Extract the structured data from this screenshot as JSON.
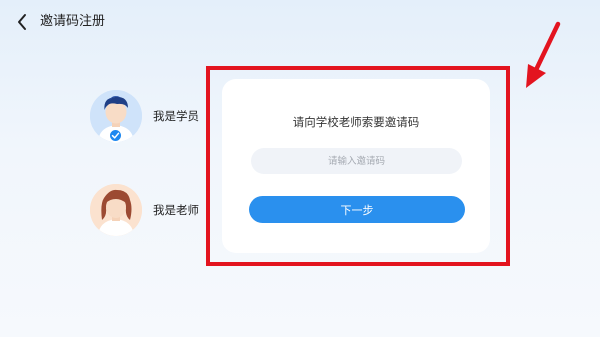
{
  "header": {
    "title": "邀请码注册",
    "back_icon": "chevron-left-icon"
  },
  "roles": [
    {
      "label": "我是学员",
      "avatar": "student-avatar",
      "selected": true,
      "badge_icon": "check-circle-icon"
    },
    {
      "label": "我是老师",
      "avatar": "teacher-avatar",
      "selected": false
    }
  ],
  "card": {
    "title": "请向学校老师索要邀请码",
    "input": {
      "placeholder": "请输入邀请码",
      "value": ""
    },
    "next_label": "下一步"
  },
  "colors": {
    "accent": "#2a90ee",
    "highlight": "#e3141f",
    "check_badge": "#1e88f0"
  },
  "annotation": {
    "icon": "red-arrow-icon"
  }
}
